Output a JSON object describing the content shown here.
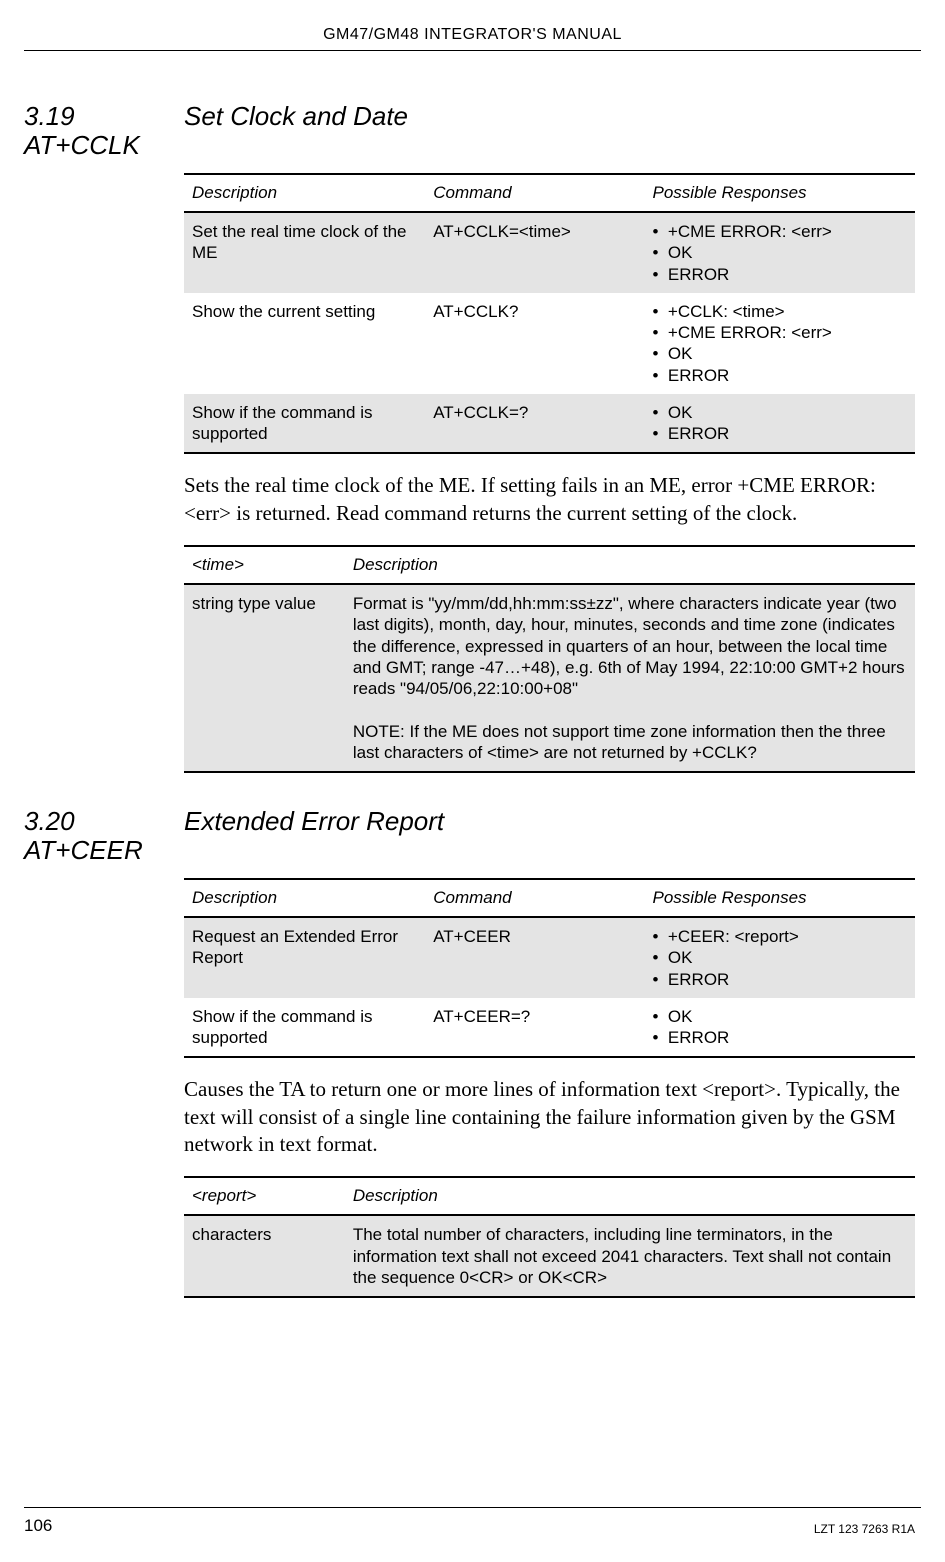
{
  "header": "GM47/GM48 INTEGRATOR'S MANUAL",
  "footer": {
    "page": "106",
    "docid": "LZT 123 7263 R1A"
  },
  "s319": {
    "num": "3.19 AT+CCLK",
    "title": "Set Clock and Date",
    "tbl_hdr": {
      "desc": "Description",
      "cmd": "Command",
      "resp": "Possible Responses"
    },
    "rows": [
      {
        "desc": "Set the real time clock of the ME",
        "cmd": "AT+CCLK=<time>",
        "resp": [
          "+CME ERROR: <err>",
          "OK",
          "ERROR"
        ]
      },
      {
        "desc": "Show the current setting",
        "cmd": "AT+CCLK?",
        "resp": [
          "+CCLK: <time>",
          "+CME ERROR: <err>",
          "OK",
          "ERROR"
        ]
      },
      {
        "desc": "Show if the command is supported",
        "cmd": "AT+CCLK=?",
        "resp": [
          "OK",
          "ERROR"
        ]
      }
    ],
    "body": "Sets the real time clock of the ME. If setting fails in an ME, error +CME ERROR: <err> is returned. Read command returns the current setting of the clock.",
    "param_hdr": {
      "p": "<time>",
      "d": "Description"
    },
    "param": {
      "name": "string type value",
      "desc1": "Format is \"yy/mm/dd,hh:mm:ss±zz\", where characters indicate year (two last digits), month, day, hour, minutes, seconds and time zone (indicates the difference, expressed in quarters of an hour, between the local time and GMT; range -47…+48), e.g. 6th of May 1994, 22:10:00 GMT+2 hours reads \"94/05/06,22:10:00+08\"",
      "desc2": "NOTE: If the ME does not support time zone information then the three last characters of <time> are not returned by +CCLK?"
    }
  },
  "s320": {
    "num": "3.20 AT+CEER",
    "title": "Extended Error Report",
    "tbl_hdr": {
      "desc": "Description",
      "cmd": "Command",
      "resp": "Possible Responses"
    },
    "rows": [
      {
        "desc": "Request an Extended Error Report",
        "cmd": "AT+CEER",
        "resp": [
          "+CEER: <report>",
          "OK",
          "ERROR"
        ]
      },
      {
        "desc": "Show if the command is supported",
        "cmd": "AT+CEER=?",
        "resp": [
          "OK",
          "ERROR"
        ]
      }
    ],
    "body": "Causes the TA to return one or more lines of information text <report>. Typically, the text will consist of a single line containing the failure information given by the GSM network in text format.",
    "param_hdr": {
      "p": "<report>",
      "d": "Description"
    },
    "param": {
      "name": "characters",
      "desc": "The total number of characters, including line terminators, in the information text shall not exceed 2041 characters. Text shall not contain the sequence 0<CR> or OK<CR>"
    }
  }
}
